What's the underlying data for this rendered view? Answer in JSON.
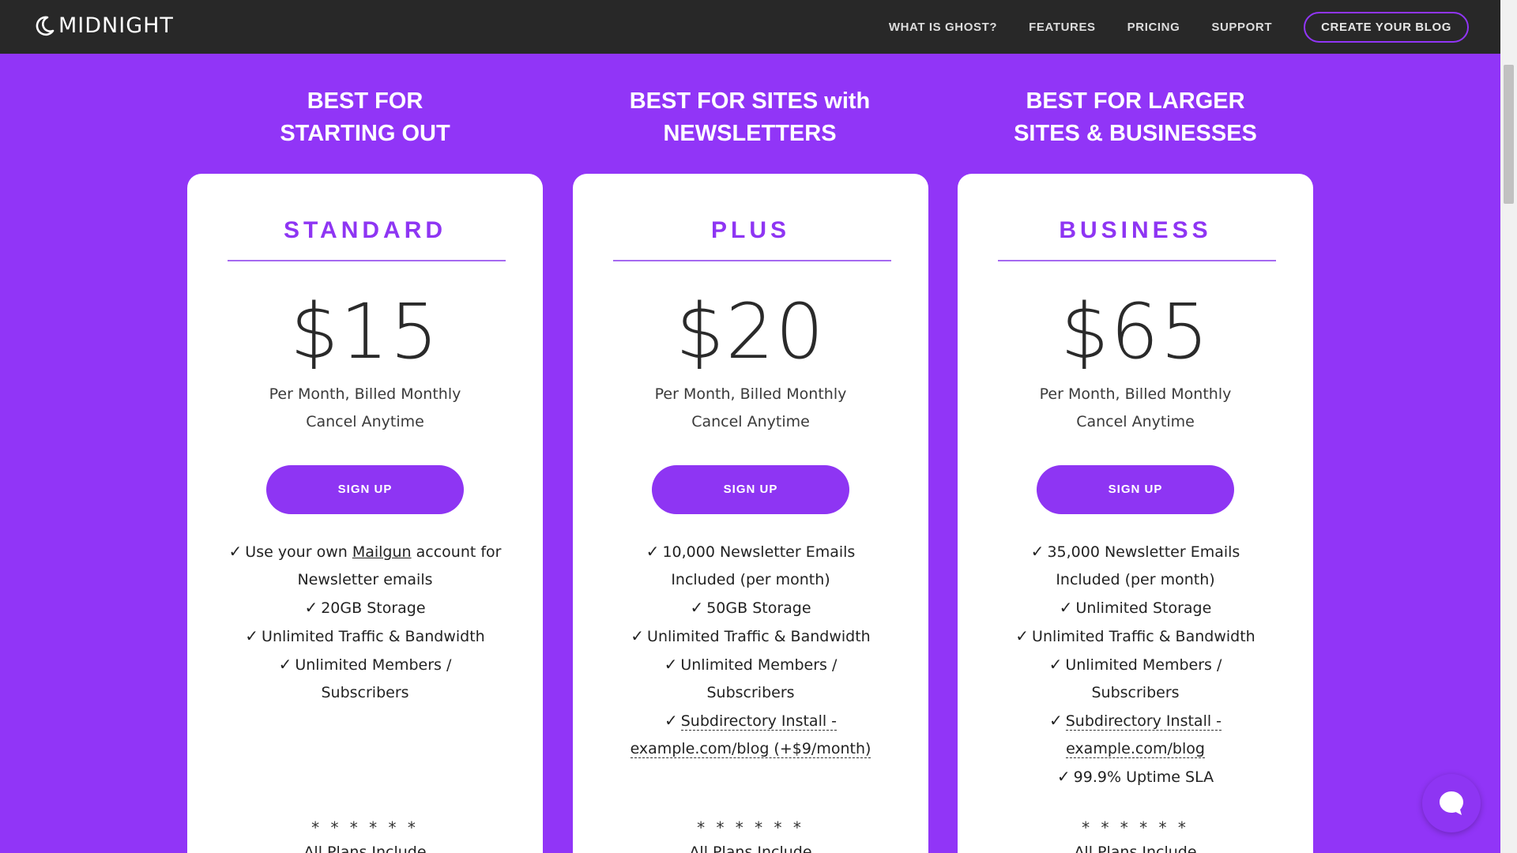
{
  "colors": {
    "background": "#9135f7",
    "navbar": "#282828",
    "accent": "#8e35f3",
    "card": "#ffffff"
  },
  "nav": {
    "logo_text": "MIDNIGHT",
    "logo_icon": "moon-icon",
    "links": [
      "WHAT IS GHOST?",
      "FEATURES",
      "PRICING",
      "SUPPORT"
    ],
    "cta": "CREATE YOUR BLOG"
  },
  "columns": [
    {
      "heading_line1": "BEST FOR",
      "heading_line2": "STARTING OUT",
      "plan": "STANDARD",
      "price": "$15",
      "billing_line1": "Per Month, Billed Monthly",
      "billing_line2": "Cancel Anytime",
      "button": "SIGN UP",
      "features": {
        "f1_pre": "Use your own ",
        "f1_link": "Mailgun",
        "f1_post": " account for Newsletter emails",
        "f2": "20GB Storage",
        "f3": "Unlimited Traffic & Bandwidth",
        "f4": "Unlimited Members / Subscribers"
      },
      "stars": "* * * * * *",
      "footer": "All Plans Include"
    },
    {
      "heading_line1": "BEST FOR SITES with",
      "heading_line2": "NEWSLETTERS",
      "plan": "PLUS",
      "price": "$20",
      "billing_line1": "Per Month, Billed Monthly",
      "billing_line2": "Cancel Anytime",
      "button": "SIGN UP",
      "features": {
        "f1": "10,000 Newsletter Emails Included (per month)",
        "f2": "50GB Storage",
        "f3": "Unlimited Traffic & Bandwidth",
        "f4": "Unlimited Members / Subscribers",
        "f5": "Subdirectory Install - example.com/blog (+$9/month)"
      },
      "stars": "* * * * * *",
      "footer": "All Plans Include"
    },
    {
      "heading_line1": "BEST FOR LARGER",
      "heading_line2": "SITES & BUSINESSES",
      "plan": "BUSINESS",
      "price": "$65",
      "billing_line1": "Per Month, Billed Monthly",
      "billing_line2": "Cancel Anytime",
      "button": "SIGN UP",
      "features": {
        "f1": "35,000 Newsletter Emails Included (per month)",
        "f2": "Unlimited Storage",
        "f3": "Unlimited Traffic & Bandwidth",
        "f4": "Unlimited Members / Subscribers",
        "f5": "Subdirectory Install - example.com/blog",
        "f6": "99.9% Uptime SLA"
      },
      "stars": "* * * * * *",
      "footer": "All Plans Include"
    }
  ],
  "check_glyph": "✓",
  "chat_icon": "chat-bubble-icon"
}
